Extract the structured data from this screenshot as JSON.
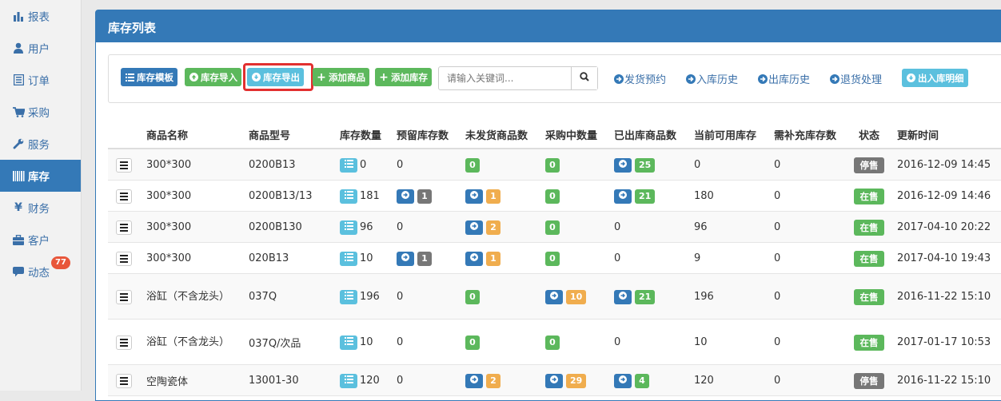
{
  "sidebar": {
    "items": [
      {
        "label": "报表",
        "icon": "bar-chart-icon"
      },
      {
        "label": "用户",
        "icon": "user-icon"
      },
      {
        "label": "订单",
        "icon": "list-icon"
      },
      {
        "label": "采购",
        "icon": "cart-icon"
      },
      {
        "label": "服务",
        "icon": "wrench-icon"
      },
      {
        "label": "库存",
        "icon": "barcode-icon",
        "active": true
      },
      {
        "label": "财务",
        "icon": "yen-icon"
      },
      {
        "label": "客户",
        "icon": "briefcase-icon"
      },
      {
        "label": "动态",
        "icon": "comment-icon",
        "badge": "77"
      }
    ]
  },
  "panel": {
    "title": "库存列表"
  },
  "toolbar": {
    "template_btn": "库存模板",
    "import_btn": "库存导入",
    "export_btn": "库存导出",
    "add_product_btn": "添加商品",
    "add_stock_btn": "添加库存",
    "search_placeholder": "请输入关键词...",
    "link_ship_reserve": "发货预约",
    "link_in_history": "入库历史",
    "link_out_history": "出库历史",
    "link_returns": "退货处理",
    "details_btn": "出入库明细"
  },
  "table": {
    "headers": [
      "商品名称",
      "商品型号",
      "库存数量",
      "预留库存数",
      "未发货商品数",
      "采购中数量",
      "已出库商品数",
      "当前可用库存",
      "需补充库存数",
      "状态",
      "更新时间"
    ],
    "rows": [
      {
        "name": "300*300",
        "model": "0200B13",
        "qty": "0",
        "reserved": "0",
        "unshipped": "0",
        "purchasing": "0",
        "shipped": "25",
        "available": "0",
        "replenish": "0",
        "status": "停售",
        "updated": "2016-12-09 14:45"
      },
      {
        "name": "300*300",
        "model": "0200B13/13",
        "qty": "181",
        "reserved": "1",
        "unshipped": "1",
        "purchasing": "0",
        "shipped": "21",
        "available": "180",
        "replenish": "0",
        "status": "在售",
        "updated": "2016-12-09 14:46"
      },
      {
        "name": "300*300",
        "model": "0200B130",
        "qty": "96",
        "reserved": "0",
        "unshipped": "2",
        "purchasing": "0",
        "shipped": "0",
        "available": "96",
        "replenish": "0",
        "status": "在售",
        "updated": "2017-04-10 20:22"
      },
      {
        "name": "300*300",
        "model": "020B13",
        "qty": "10",
        "reserved": "1",
        "unshipped": "1",
        "purchasing": "0",
        "shipped": "0",
        "available": "9",
        "replenish": "0",
        "status": "在售",
        "updated": "2017-04-10 19:43"
      },
      {
        "name": "浴缸（不含龙头）",
        "model": "037Q",
        "qty": "196",
        "reserved": "0",
        "unshipped": "0",
        "purchasing": "10",
        "shipped": "21",
        "available": "196",
        "replenish": "0",
        "status": "在售",
        "updated": "2016-11-22 15:10"
      },
      {
        "name": "浴缸（不含龙头）",
        "model": "037Q/次品",
        "qty": "10",
        "reserved": "0",
        "unshipped": "0",
        "purchasing": "0",
        "shipped": "0",
        "available": "10",
        "replenish": "0",
        "status": "在售",
        "updated": "2017-01-17 10:53"
      },
      {
        "name": "空陶瓷体",
        "model": "13001-30",
        "qty": "120",
        "reserved": "0",
        "unshipped": "2",
        "purchasing": "29",
        "shipped": "4",
        "available": "120",
        "replenish": "0",
        "status": "停售",
        "updated": "2016-11-22 15:10"
      }
    ]
  },
  "colors": {
    "primary": "#3479b7",
    "success": "#5cb85c",
    "info": "#5bc0de",
    "warning": "#f0ad4e",
    "default": "#777777",
    "highlight": "#e23030"
  }
}
